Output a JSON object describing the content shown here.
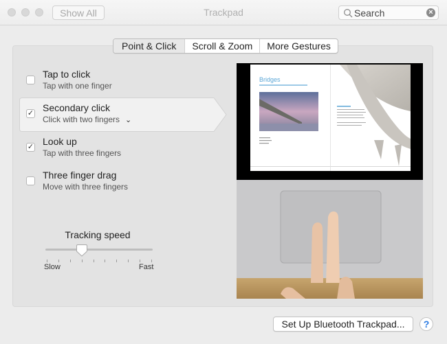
{
  "window": {
    "title": "Trackpad",
    "show_all_label": "Show All",
    "search": {
      "value": "Search",
      "icon": "search-icon",
      "clear_icon": "clear-icon"
    }
  },
  "tabs": [
    {
      "label": "Point & Click",
      "selected": true
    },
    {
      "label": "Scroll & Zoom",
      "selected": false
    },
    {
      "label": "More Gestures",
      "selected": false
    }
  ],
  "options": [
    {
      "title": "Tap to click",
      "subtitle": "Tap with one finger",
      "checked": false,
      "selected": false
    },
    {
      "title": "Secondary click",
      "subtitle": "Click with two fingers",
      "checked": true,
      "selected": true,
      "has_dropdown": true
    },
    {
      "title": "Look up",
      "subtitle": "Tap with three fingers",
      "checked": true,
      "selected": false
    },
    {
      "title": "Three finger drag",
      "subtitle": "Move with three fingers",
      "checked": false,
      "selected": false
    }
  ],
  "tracking_speed": {
    "label": "Tracking speed",
    "min_label": "Slow",
    "max_label": "Fast",
    "tick_count": 10,
    "value_fraction": 0.333
  },
  "preview": {
    "description": "Two fingers clicking on a trackpad, with a document titled Bridges shown above",
    "doc_title": "Bridges",
    "colors": {
      "doc_title": "#5aa6d6",
      "trackpad": "#c8c8ca",
      "desk": "#b99662"
    }
  },
  "footer": {
    "setup_button_label": "Set Up Bluetooth Trackpad...",
    "help_label": "?"
  },
  "colors": {
    "accent": "#2a7ae2",
    "panel": "#e3e3e3",
    "window_bg": "#ececec"
  }
}
